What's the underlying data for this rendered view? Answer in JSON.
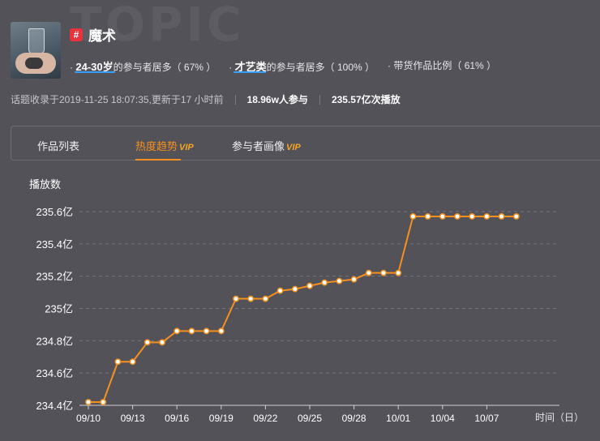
{
  "header": {
    "watermark": "TOPIC",
    "topic_title": "魔术",
    "hash_symbol": "#",
    "stats": [
      {
        "prefix": "· ",
        "highlight": "24-30岁",
        "suffix": "的参与者居多（ 67% ）"
      },
      {
        "prefix": "· ",
        "highlight": "才艺类",
        "suffix": "的参与者居多（ 100% ）"
      },
      {
        "prefix": "· ",
        "highlight": "",
        "suffix": "带货作品比例（ 61% ）"
      }
    ],
    "meta": {
      "collected": "话题收录于2019-11-25 18:07:35,更新于17 小时前",
      "participants": "18.96w人参与",
      "plays": "235.57亿次播放"
    }
  },
  "tabs": [
    {
      "label": "作品列表",
      "vip": ""
    },
    {
      "label": "热度趋势",
      "vip": "VIP"
    },
    {
      "label": "参与者画像",
      "vip": "VIP"
    }
  ],
  "active_tab": 1,
  "colors": {
    "accent": "#f5901e",
    "line": "#f5901e",
    "background": "#535258"
  },
  "chart_data": {
    "type": "line",
    "ylabel": "播放数",
    "xlabel": "时间（日）",
    "ylim": [
      234.4,
      235.6
    ],
    "y_ticks": [
      234.4,
      234.6,
      234.8,
      235.0,
      235.2,
      235.4,
      235.6
    ],
    "y_tick_labels": [
      "234.4亿",
      "234.6亿",
      "234.8亿",
      "235亿",
      "235.2亿",
      "235.4亿",
      "235.6亿"
    ],
    "x_tick_labels": [
      "09/10",
      "09/13",
      "09/16",
      "09/19",
      "09/22",
      "09/25",
      "09/28",
      "10/01",
      "10/04",
      "10/07"
    ],
    "x": [
      "09/10",
      "09/11",
      "09/12",
      "09/13",
      "09/14",
      "09/15",
      "09/16",
      "09/17",
      "09/18",
      "09/19",
      "09/20",
      "09/21",
      "09/22",
      "09/23",
      "09/24",
      "09/25",
      "09/26",
      "09/27",
      "09/28",
      "09/29",
      "09/30",
      "10/01",
      "10/02",
      "10/03",
      "10/04",
      "10/05",
      "10/06",
      "10/07",
      "10/08",
      "10/09"
    ],
    "series": [
      {
        "values": [
          234.42,
          234.42,
          234.67,
          234.67,
          234.79,
          234.79,
          234.86,
          234.86,
          234.86,
          234.86,
          235.06,
          235.06,
          235.06,
          235.11,
          235.12,
          235.14,
          235.16,
          235.17,
          235.18,
          235.22,
          235.22,
          235.22,
          235.57,
          235.57,
          235.57,
          235.57,
          235.57,
          235.57,
          235.57,
          235.57
        ]
      }
    ],
    "grid": true
  }
}
